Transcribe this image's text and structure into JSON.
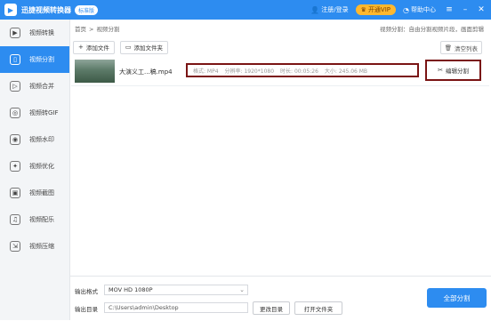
{
  "titlebar": {
    "app_title": "迅捷视频转换器",
    "badge": "标准版",
    "login": "注册/登录",
    "vip": "开通VIP",
    "help": "帮助中心",
    "menu_icon": "≡",
    "min_icon": "–",
    "close_icon": "✕"
  },
  "sidebar": {
    "items": [
      {
        "label": "视频转换",
        "icon": "video-convert-icon",
        "glyph": "▶"
      },
      {
        "label": "视频分割",
        "icon": "video-split-icon",
        "glyph": "▯"
      },
      {
        "label": "视频合并",
        "icon": "video-merge-icon",
        "glyph": "▷"
      },
      {
        "label": "视频转GIF",
        "icon": "gif-icon",
        "glyph": "◎"
      },
      {
        "label": "视频水印",
        "icon": "watermark-icon",
        "glyph": "◉"
      },
      {
        "label": "视频优化",
        "icon": "optimize-icon",
        "glyph": "✦"
      },
      {
        "label": "视频截图",
        "icon": "screenshot-icon",
        "glyph": "▣"
      },
      {
        "label": "视频配乐",
        "icon": "music-icon",
        "glyph": "♫"
      },
      {
        "label": "视频压缩",
        "icon": "compress-icon",
        "glyph": "⇲"
      }
    ],
    "active_index": 1
  },
  "breadcrumb": {
    "home": "首页",
    "sep": ">",
    "current": "视频分割"
  },
  "tip": "视频分割：自由分割视频片段，画面剪辑",
  "toolbar": {
    "add_file": "添加文件",
    "add_folder": "添加文件夹",
    "clear": "清空列表"
  },
  "files": [
    {
      "name": "大演义工...稿.mp4",
      "format": "格式: MP4",
      "resolution": "分辨率: 1920*1080",
      "duration": "时长: 00:05:26",
      "size": "大小: 245.06 MB",
      "action": "编辑分割"
    }
  ],
  "bottom": {
    "format_label": "输出格式",
    "format_value": "MOV  HD 1080P",
    "dir_label": "输出目录",
    "dir_value": "C:\\Users\\admin\\Desktop",
    "change_dir": "更改目录",
    "open_folder": "打开文件夹",
    "split_all": "全部分割"
  },
  "colors": {
    "accent": "#2d8cf0",
    "highlight_box": "#7a1414",
    "vip": "#ffb82e"
  }
}
